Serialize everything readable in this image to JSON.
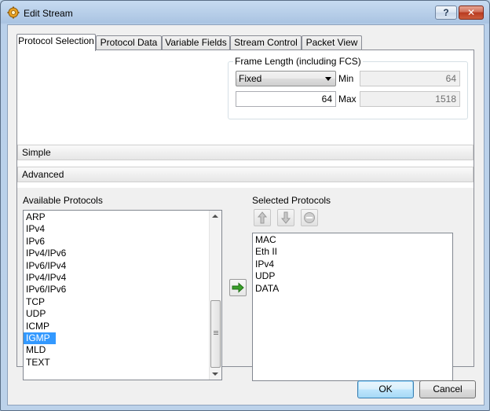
{
  "window": {
    "title": "Edit Stream",
    "help_label": "?",
    "close_label": "✕"
  },
  "tabs": [
    {
      "label": "Protocol Selection",
      "active": true
    },
    {
      "label": "Protocol Data"
    },
    {
      "label": "Variable Fields"
    },
    {
      "label": "Stream Control"
    },
    {
      "label": "Packet View"
    }
  ],
  "frame_length": {
    "group_title": "Frame Length (including FCS)",
    "mode": "Fixed",
    "length_value": "64",
    "min_label": "Min",
    "min_value": "64",
    "max_label": "Max",
    "max_value": "1518"
  },
  "sections": {
    "simple": "Simple",
    "advanced": "Advanced"
  },
  "available": {
    "label": "Available Protocols",
    "items": [
      "ARP",
      "IPv4",
      "IPv6",
      "IPv4/IPv6",
      "IPv6/IPv4",
      "IPv4/IPv4",
      "IPv6/IPv6",
      "TCP",
      "UDP",
      "ICMP",
      "IGMP",
      "MLD",
      "TEXT"
    ],
    "selected": "IGMP"
  },
  "selected_protocols": {
    "label": "Selected Protocols",
    "items": [
      "MAC",
      "Eth II",
      "IPv4",
      "UDP",
      "DATA"
    ]
  },
  "icons": {
    "title": "gear-icon",
    "add": "right-arrow-icon",
    "up": "up-arrow-icon",
    "down": "down-arrow-icon",
    "remove": "remove-icon"
  },
  "buttons": {
    "ok": "OK",
    "cancel": "Cancel"
  }
}
